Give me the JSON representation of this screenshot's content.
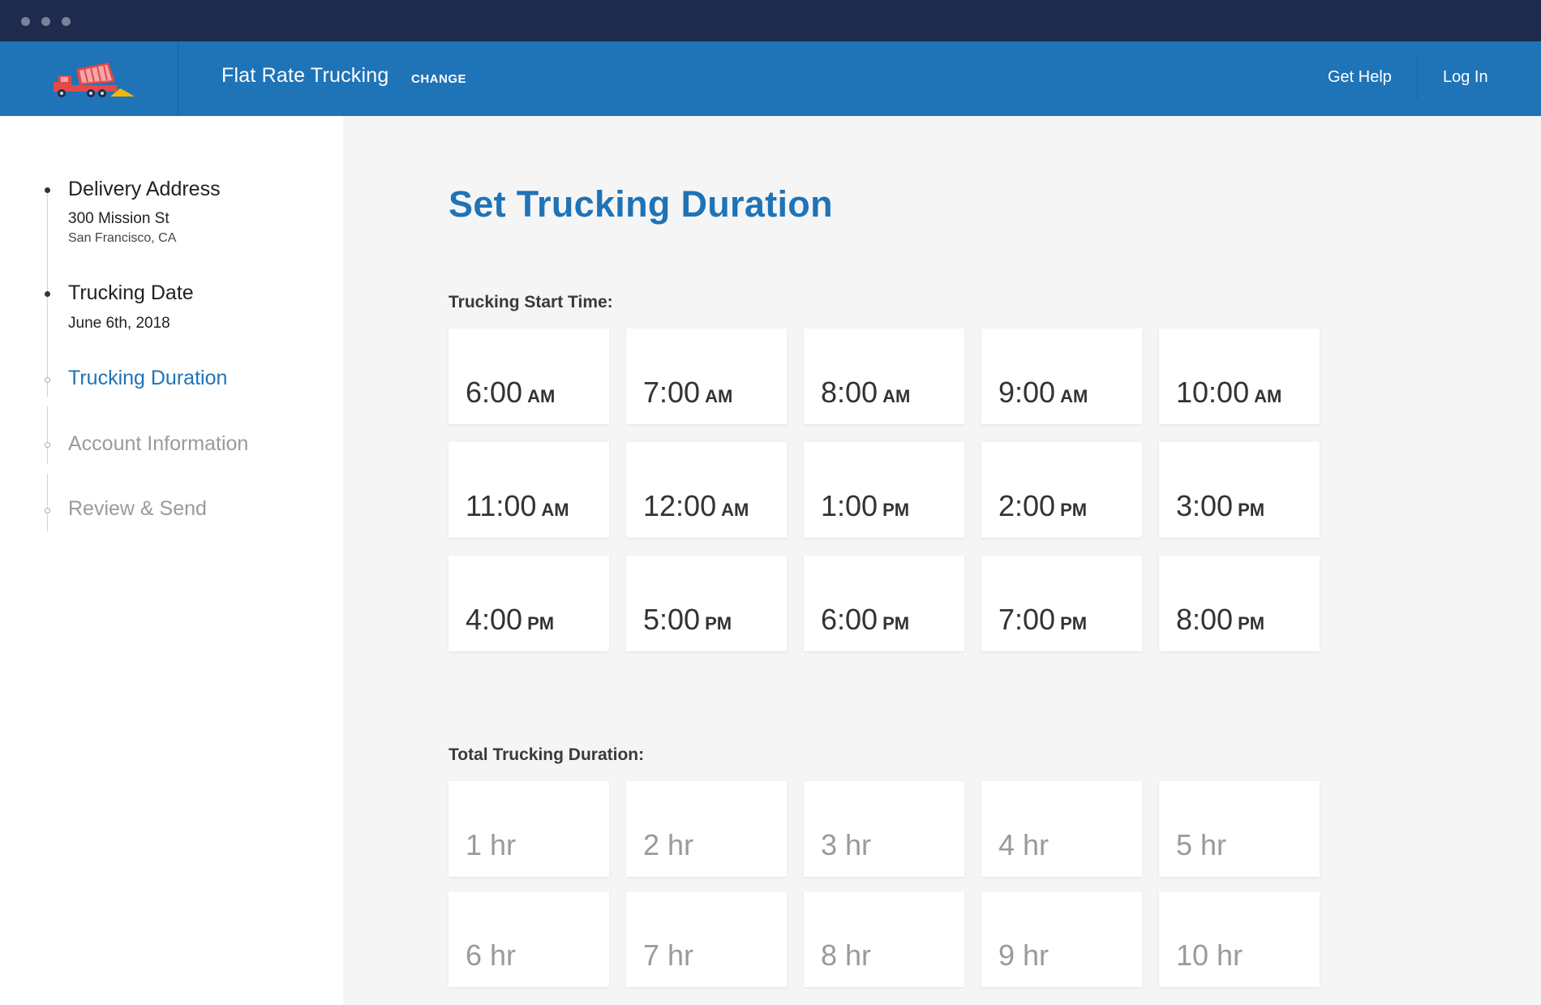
{
  "window": {
    "controls": [
      "close-dot",
      "minimize-dot",
      "maximize-dot"
    ]
  },
  "header": {
    "app_title": "Flat Rate Trucking",
    "change_label": "CHANGE",
    "help_label": "Get Help",
    "login_label": "Log In",
    "colors": {
      "bar": "#1f73b7",
      "titlebar": "#1e2a4e",
      "logo_truck": "#e04a4a",
      "logo_dirt": "#f2b705"
    }
  },
  "steps": [
    {
      "title": "Delivery Address",
      "line1": "300 Mission St",
      "line2": "San Francisco, CA",
      "state": "done"
    },
    {
      "title": "Trucking Date",
      "line1": "June 6th, 2018",
      "state": "done"
    },
    {
      "title": "Trucking Duration",
      "state": "active"
    },
    {
      "title": "Account Information",
      "state": "pending"
    },
    {
      "title": "Review &  Send",
      "state": "pending"
    }
  ],
  "main": {
    "title": "Set Trucking Duration",
    "start_label": "Trucking Start Time:",
    "duration_label": "Total Trucking Duration:",
    "start_times": [
      {
        "time": "6:00",
        "period": "AM"
      },
      {
        "time": "7:00",
        "period": "AM"
      },
      {
        "time": "8:00",
        "period": "AM"
      },
      {
        "time": "9:00",
        "period": "AM"
      },
      {
        "time": "10:00",
        "period": "AM"
      },
      {
        "time": "11:00",
        "period": "AM"
      },
      {
        "time": "12:00",
        "period": "AM"
      },
      {
        "time": "1:00",
        "period": "PM"
      },
      {
        "time": "2:00",
        "period": "PM"
      },
      {
        "time": "3:00",
        "period": "PM"
      },
      {
        "time": "4:00",
        "period": "PM"
      },
      {
        "time": "5:00",
        "period": "PM"
      },
      {
        "time": "6:00",
        "period": "PM"
      },
      {
        "time": "7:00",
        "period": "PM"
      },
      {
        "time": "8:00",
        "period": "PM"
      }
    ],
    "durations": [
      "1 hr",
      "2 hr",
      "3 hr",
      "4 hr",
      "5 hr",
      "6 hr",
      "7 hr",
      "8 hr",
      "9 hr",
      "10 hr"
    ]
  }
}
